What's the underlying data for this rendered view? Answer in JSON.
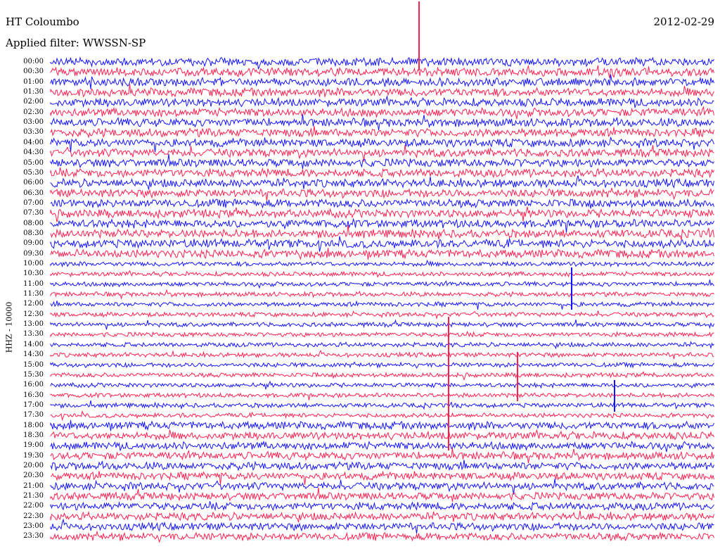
{
  "header": {
    "station": "HT Coloumbo",
    "date": "2012-02-29",
    "filter": "Applied filter: WWSSN-SP"
  },
  "channel_label": "HHZ - 10000",
  "trace_colors": [
    "#1414ff",
    "#ff2050"
  ],
  "time_labels": [
    "00:00",
    "00:30",
    "01:00",
    "01:30",
    "02:00",
    "02:30",
    "03:00",
    "03:30",
    "04:00",
    "04:30",
    "05:00",
    "05:30",
    "06:00",
    "06:30",
    "07:00",
    "07:30",
    "08:00",
    "08:30",
    "09:00",
    "09:30",
    "10:00",
    "10:30",
    "11:00",
    "11:30",
    "12:00",
    "12:30",
    "13:00",
    "13:30",
    "14:00",
    "14:30",
    "15:00",
    "15:30",
    "16:00",
    "16:30",
    "17:00",
    "17:30",
    "18:00",
    "18:30",
    "19:00",
    "19:30",
    "20:00",
    "20:30",
    "21:00",
    "21:30",
    "22:00",
    "22:30",
    "23:00",
    "23:30"
  ]
}
